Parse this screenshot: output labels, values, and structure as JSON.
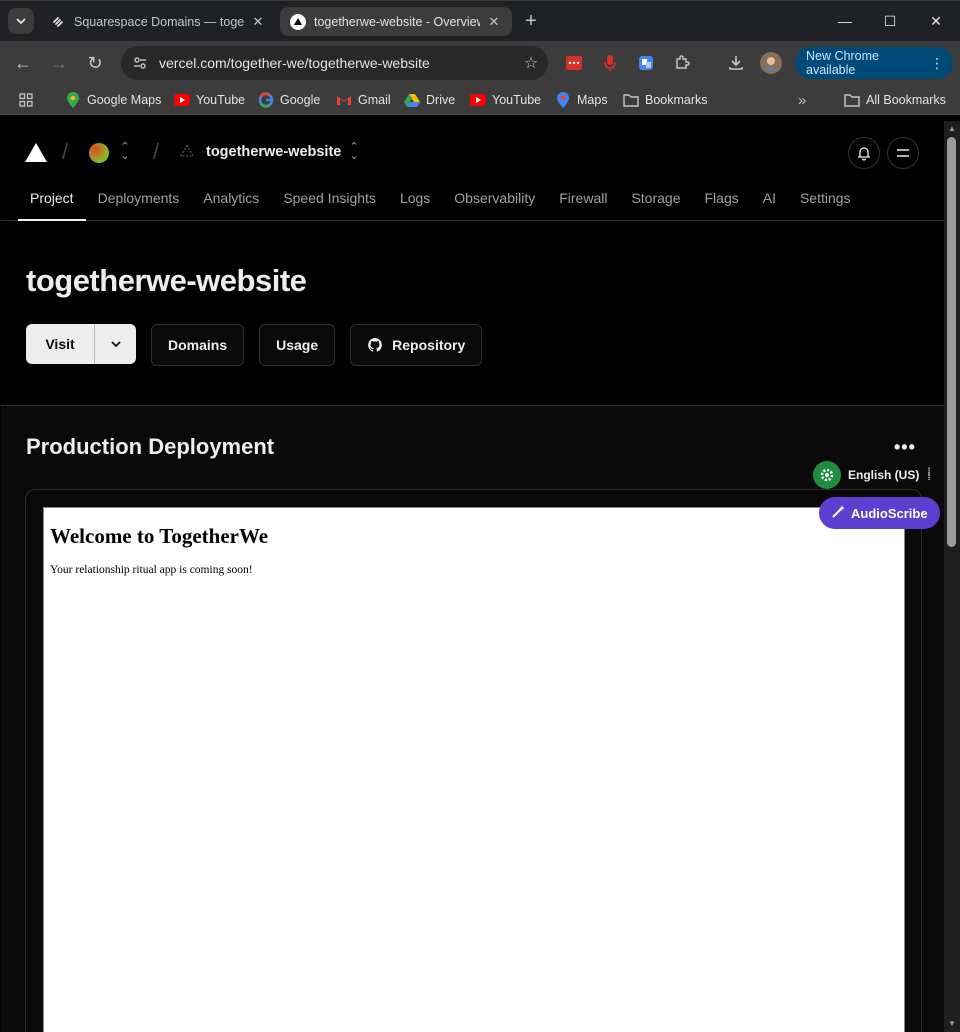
{
  "browser": {
    "tabs": [
      {
        "title": "Squarespace Domains — togetherwe",
        "active": false
      },
      {
        "title": "togetherwe-website - Overview",
        "active": true
      }
    ],
    "url": "vercel.com/together-we/togetherwe-website",
    "update_label": "New Chrome available",
    "bookmarks": [
      "Google Maps",
      "YouTube",
      "Google",
      "Gmail",
      "Drive",
      "YouTube",
      "Maps",
      "Bookmarks"
    ],
    "all_bookmarks": "All Bookmarks"
  },
  "vercel": {
    "project_name": "togetherwe-website",
    "nav": [
      "Project",
      "Deployments",
      "Analytics",
      "Speed Insights",
      "Logs",
      "Observability",
      "Firewall",
      "Storage",
      "Flags",
      "AI",
      "Settings"
    ],
    "title": "togetherwe-website",
    "buttons": {
      "visit": "Visit",
      "domains": "Domains",
      "usage": "Usage",
      "repository": "Repository"
    },
    "section_title": "Production Deployment",
    "preview": {
      "heading": "Welcome to TogetherWe",
      "text": "Your relationship ritual app is coming soon!"
    }
  },
  "overlays": {
    "language": "English (US)",
    "audioscribe": "AudioScribe"
  },
  "colors": {
    "accent_blue": "#004a77",
    "audioscribe": "#5b3fd1",
    "gear_green": "#1e8e3e"
  }
}
